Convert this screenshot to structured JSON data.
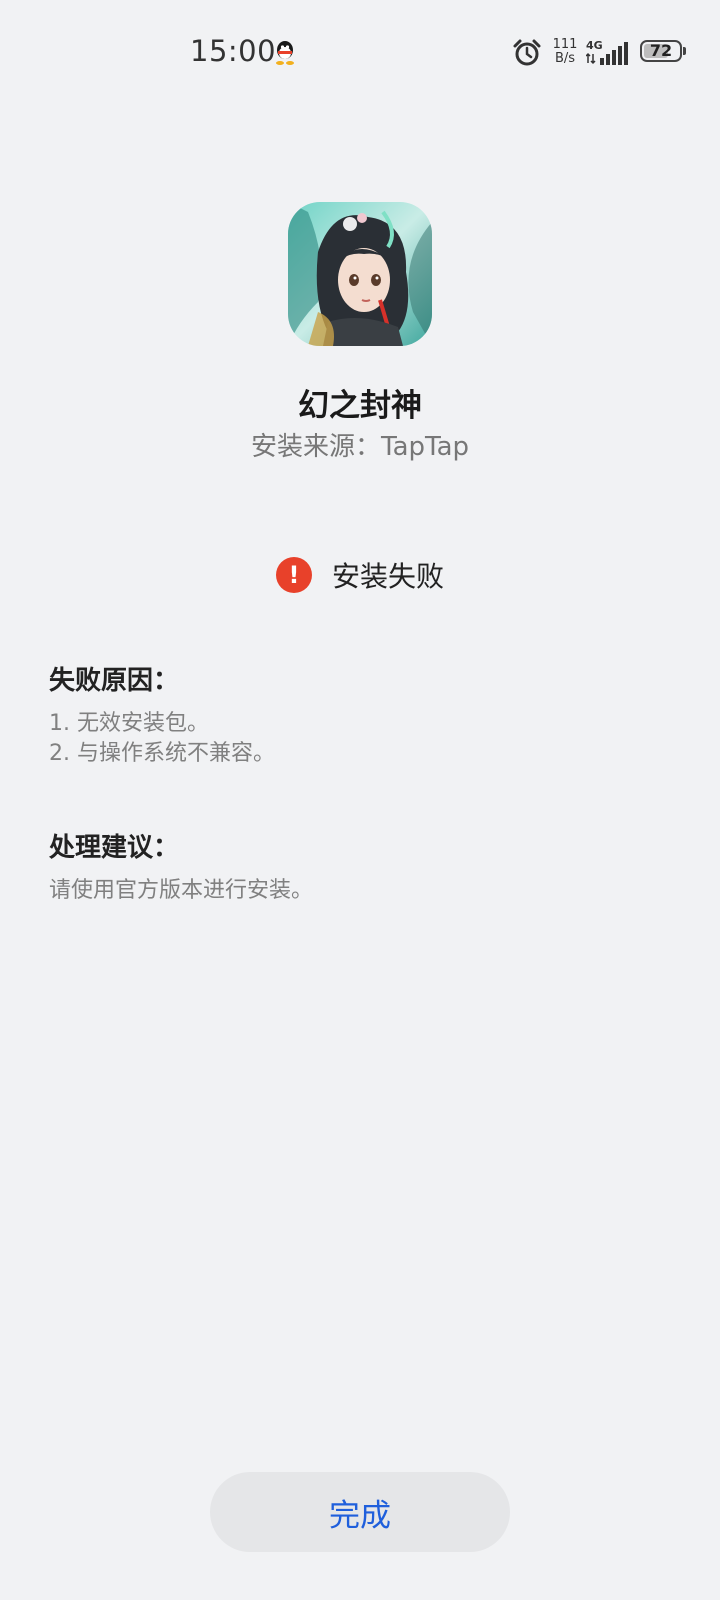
{
  "status_bar": {
    "time": "15:00",
    "net_speed_value": "111",
    "net_speed_unit": "B/s",
    "network_type": "4G",
    "battery_level": "72",
    "icons": [
      "qq-icon",
      "alarm-icon",
      "signal-icon",
      "battery-icon"
    ]
  },
  "app": {
    "name": "幻之封神",
    "install_source": "安装来源：TapTap",
    "icon": "app-icon-anime-girl"
  },
  "result": {
    "status_icon": "error-icon",
    "status_icon_glyph": "!",
    "status_text": "安装失败",
    "status_color": "#e8412a"
  },
  "failure_reason": {
    "title": "失败原因：",
    "lines": [
      "1. 无效安装包。",
      "2. 与操作系统不兼容。"
    ]
  },
  "suggestion": {
    "title": "处理建议：",
    "lines": [
      "请使用官方版本进行安装。"
    ]
  },
  "done_button": {
    "label": "完成",
    "color": "#1f5fdc"
  }
}
